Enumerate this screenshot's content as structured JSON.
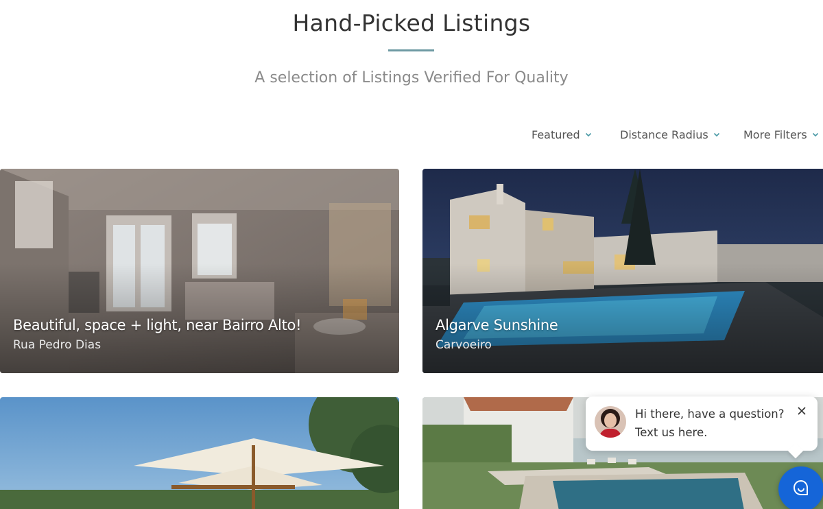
{
  "header": {
    "title": "Hand-Picked Listings",
    "subtitle": "A selection of Listings Verified For Quality"
  },
  "filters": {
    "featured": "Featured",
    "distance": "Distance Radius",
    "more": "More Filters"
  },
  "listings": [
    {
      "title": "Beautiful, space + light, near Bairro Alto!",
      "location": "Rua Pedro Dias"
    },
    {
      "title": "Algarve Sunshine",
      "location": "Carvoeiro"
    },
    {
      "title": "",
      "location": ""
    },
    {
      "title": "",
      "location": ""
    }
  ],
  "chat": {
    "line1": "Hi there, have a question?",
    "line2": "Text us here."
  },
  "colors": {
    "accent_rule": "#6e9aa3",
    "chat_button": "#1565d8"
  },
  "icons": [
    "chevron-down-icon",
    "close-icon",
    "chat-icon"
  ]
}
